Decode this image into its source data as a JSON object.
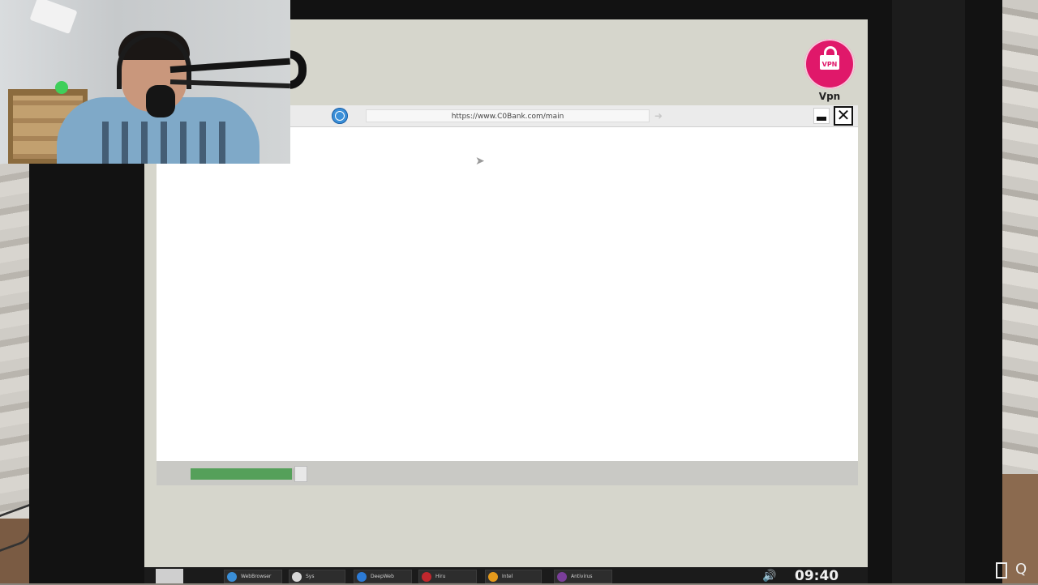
{
  "desktop": {
    "vpn_icon": {
      "badge_text": "VPN",
      "label": "Vpn",
      "color": "#e0186a"
    }
  },
  "browser": {
    "url": "https://www.C0Bank.com/main",
    "go_icon": "arrow-right-icon",
    "window_buttons": {
      "minimize": "minimize-icon",
      "close": "close-icon",
      "close_glyph": "✕"
    },
    "loading_progress": 0.95
  },
  "taskbar": {
    "items": [
      {
        "label": "WebBrowser",
        "icon_color": "#3a8fd8"
      },
      {
        "label": "Sys",
        "icon_color": "#d9d9d9"
      },
      {
        "label": "DeepWeb",
        "icon_color": "#2c7bd6"
      },
      {
        "label": "Hiru",
        "icon_color": "#c0272d"
      },
      {
        "label": "Intel",
        "icon_color": "#e59a1c"
      },
      {
        "label": "Antivirus",
        "icon_color": "#7a3e9a"
      }
    ],
    "volume_icon": "speaker-icon",
    "clock": "09:40"
  },
  "desk": {
    "exit_icon": "door-icon",
    "search_glyph": "Q"
  },
  "colors": {
    "screen_bg": "#d6d6cc",
    "progress_green": "#55a05a"
  }
}
